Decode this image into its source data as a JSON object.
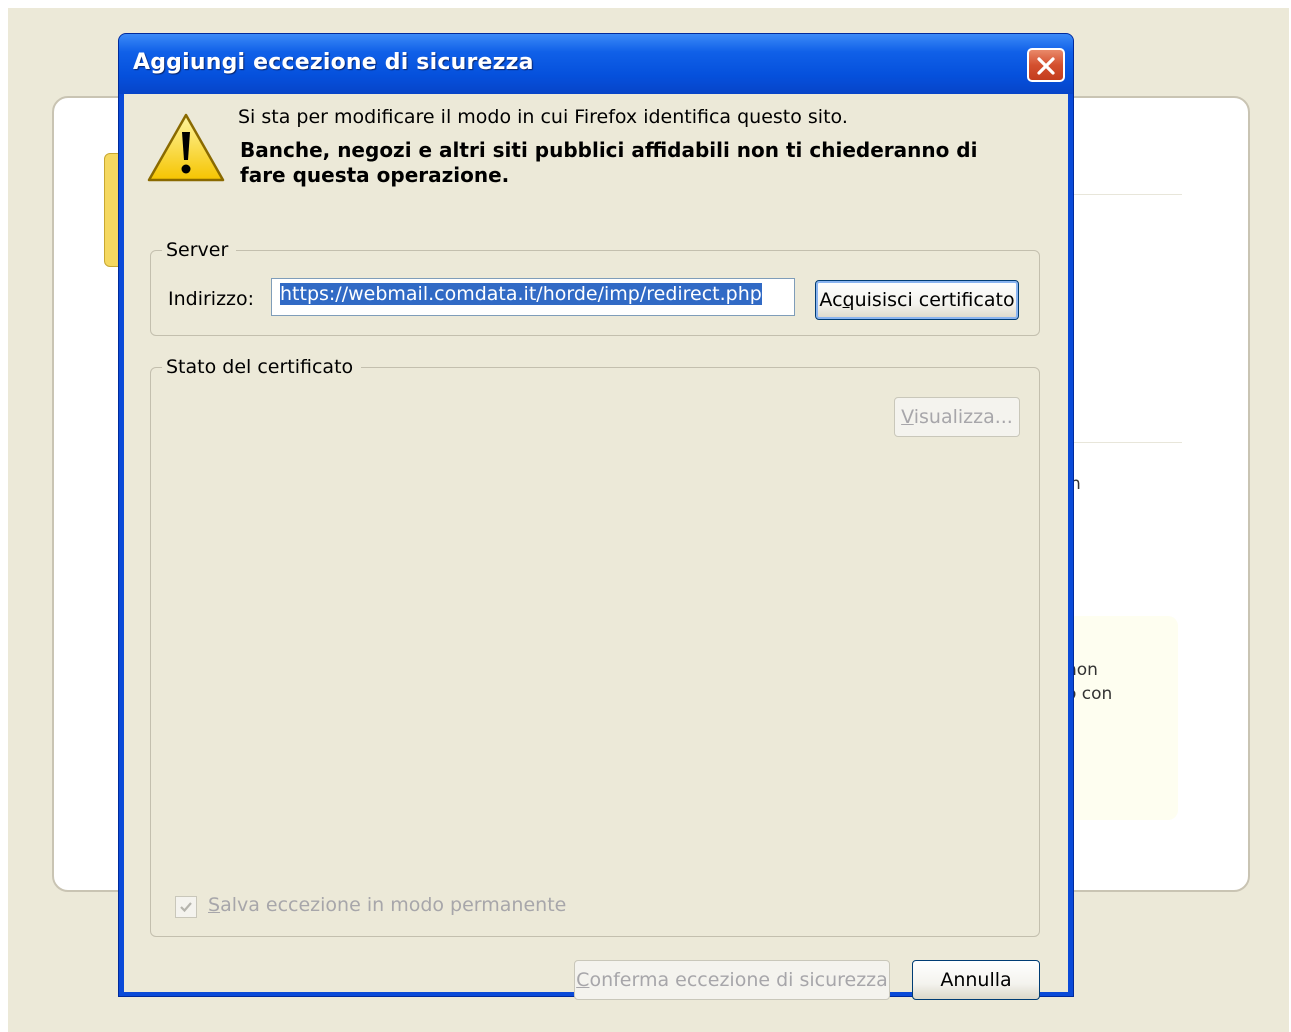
{
  "background": {
    "fragment_1": "n",
    "fragment_2": "non",
    "fragment_3": "o con"
  },
  "dialog": {
    "title": "Aggiungi eccezione di sicurezza",
    "icons": {
      "close": "close-icon",
      "warning": "warning-icon",
      "check": "checkmark-icon"
    },
    "warning": {
      "line1": "Si sta per modificare il modo in cui Firefox identifica questo sito.",
      "line2": "Banche, negozi e altri siti pubblici affidabili non ti chiederanno di fare questa operazione."
    },
    "server_group": {
      "legend": "Server",
      "address_label": "Indirizzo:",
      "address_value": "https://webmail.comdata.it/horde/imp/redirect.php",
      "get_certificate_button": {
        "label_before": "Ac",
        "label_underlined": "q",
        "label_after": "uisisci certificato"
      }
    },
    "status_group": {
      "legend": "Stato del certificato",
      "view_button": {
        "label_underlined": "V",
        "label_after": "isualizza..."
      },
      "permanent_checkbox": {
        "label_underlined": "S",
        "label_after": "alva eccezione in modo permanente",
        "checked": true,
        "disabled": true
      }
    },
    "buttons": {
      "confirm": {
        "label_underlined": "C",
        "label_after": "onferma eccezione di sicurezza",
        "disabled": true
      },
      "cancel": {
        "label": "Annulla"
      }
    },
    "colors": {
      "titlebar": "#0550dc",
      "close_button": "#d4502f",
      "client_background": "#ece9d8",
      "selection": "#316ac5"
    }
  }
}
